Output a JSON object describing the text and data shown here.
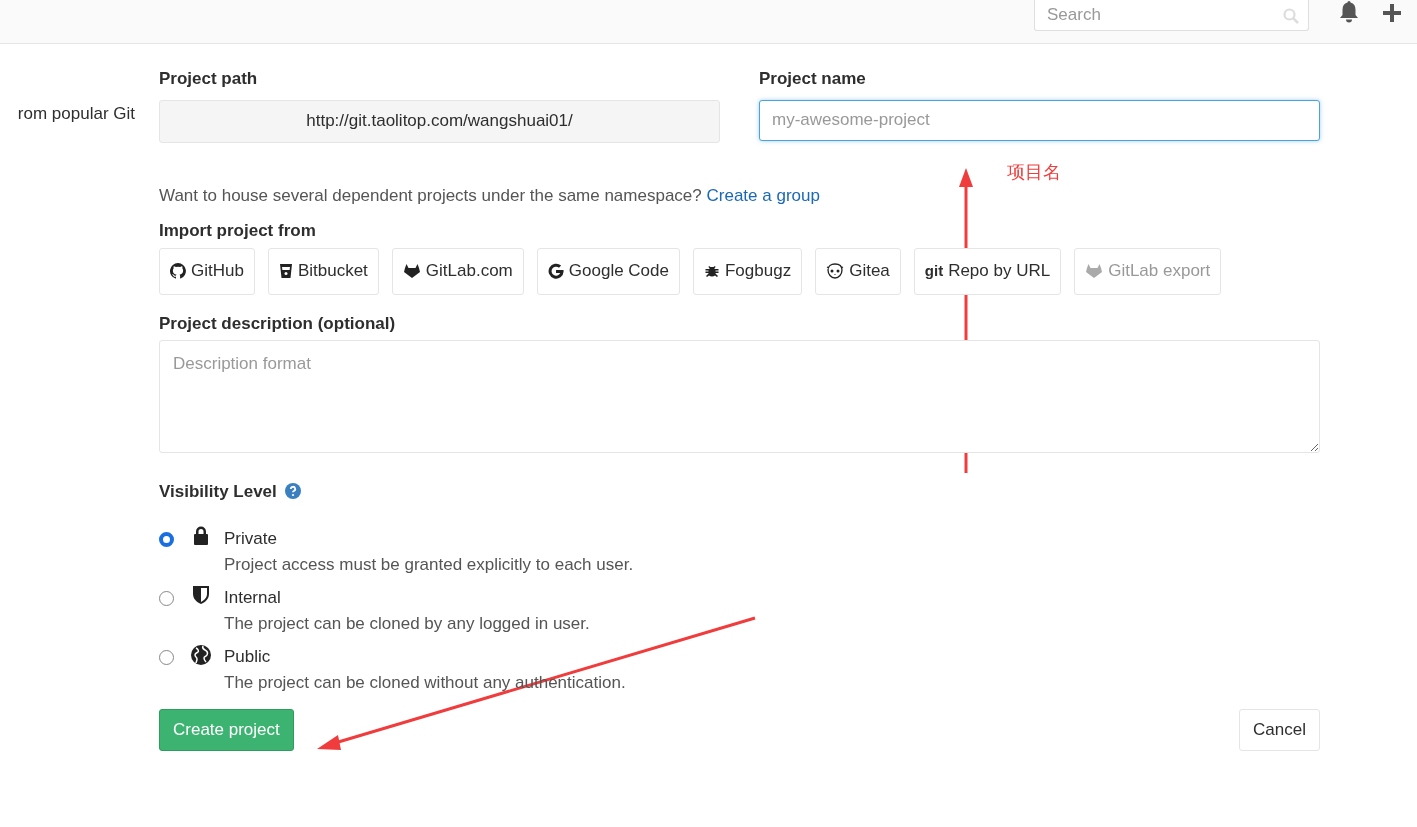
{
  "header": {
    "search": {
      "placeholder": "Search"
    }
  },
  "sidebar_text": "rom popular Git",
  "project_path": {
    "label": "Project path",
    "value": "http://git.taolitop.com/wangshuai01/"
  },
  "project_name": {
    "label": "Project name",
    "placeholder": "my-awesome-project"
  },
  "group_hint": {
    "text": "Want to house several dependent projects under the same namespace?",
    "link": "Create a group"
  },
  "import": {
    "label": "Import project from",
    "sources": [
      {
        "label": "GitHub",
        "disabled": false
      },
      {
        "label": "Bitbucket",
        "disabled": false
      },
      {
        "label": "GitLab.com",
        "disabled": false
      },
      {
        "label": "Google Code",
        "disabled": false
      },
      {
        "label": "Fogbugz",
        "disabled": false
      },
      {
        "label": "Gitea",
        "disabled": false
      },
      {
        "label": "Repo by URL",
        "icon_text": "git",
        "disabled": false
      },
      {
        "label": "GitLab export",
        "disabled": true
      }
    ]
  },
  "description": {
    "label": "Project description (optional)",
    "placeholder": "Description format"
  },
  "visibility": {
    "label": "Visibility Level",
    "options": [
      {
        "name": "Private",
        "description": "Project access must be granted explicitly to each user.",
        "selected": true
      },
      {
        "name": "Internal",
        "description": "The project can be cloned by any logged in user.",
        "selected": false
      },
      {
        "name": "Public",
        "description": "The project can be cloned without any authentication.",
        "selected": false
      }
    ]
  },
  "buttons": {
    "create": "Create project",
    "cancel": "Cancel"
  },
  "annotations": [
    {
      "text": "项目名"
    }
  ]
}
